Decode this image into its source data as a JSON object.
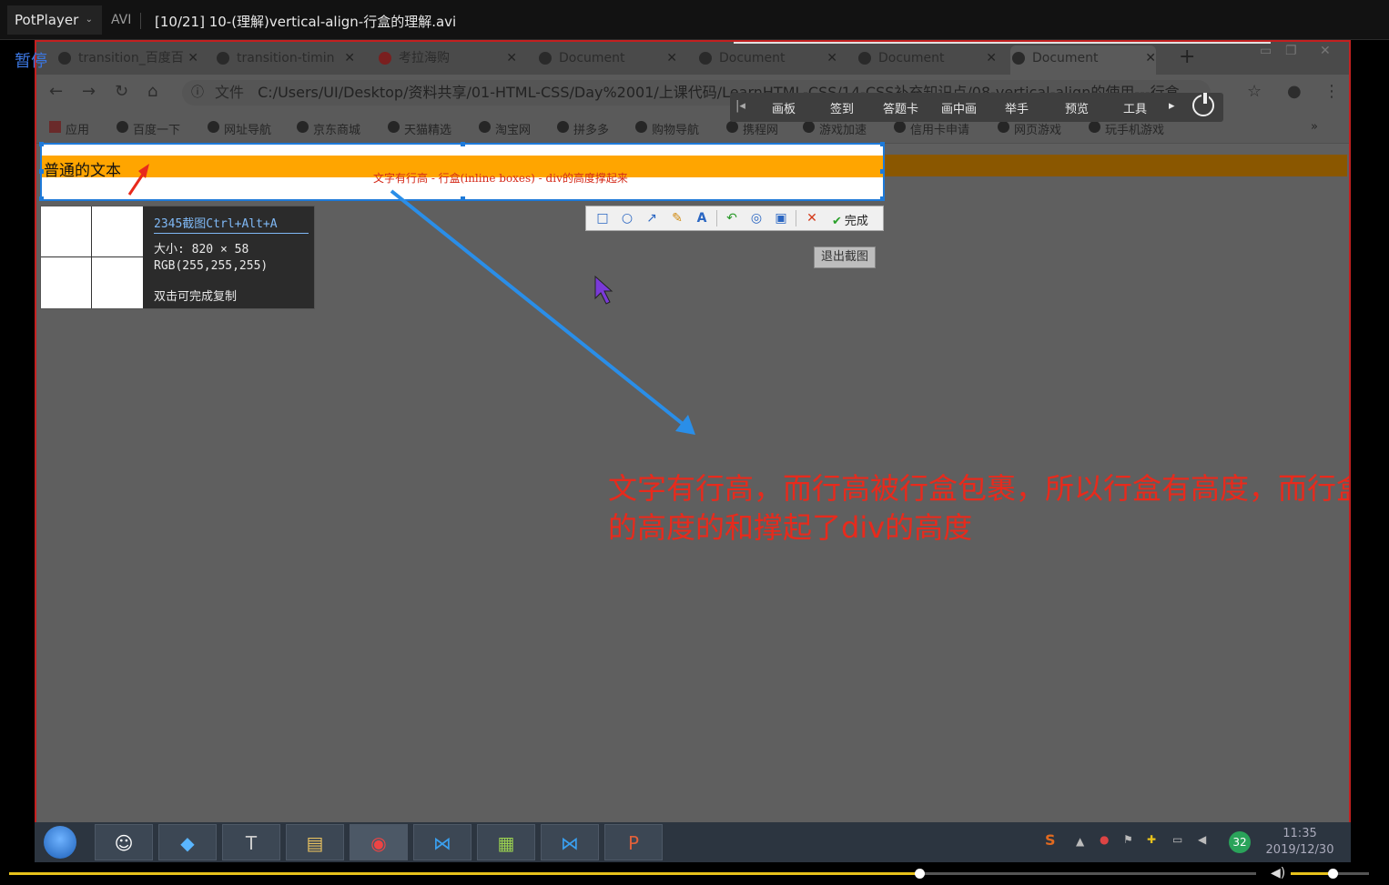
{
  "player": {
    "brand": "PotPlayer",
    "format": "AVI",
    "file_title": "[10/21] 10-(理解)vertical-align-行盒的理解.avi",
    "pause_label": "暂停",
    "seek_progress": 0.73,
    "volume_level": 0.53,
    "accent_color": "#e8c21c"
  },
  "browser": {
    "tabs": [
      {
        "label": "transition_百度百",
        "icon": "baidu-paw-icon"
      },
      {
        "label": "transition-timin",
        "icon": "site-icon"
      },
      {
        "label": "考拉海购",
        "icon": "kaola-icon"
      },
      {
        "label": "Document",
        "icon": "globe-icon"
      },
      {
        "label": "Document",
        "icon": "globe-icon"
      },
      {
        "label": "Document",
        "icon": "globe-icon"
      },
      {
        "label": "Document",
        "icon": "globe-icon"
      }
    ],
    "new_tab": "+",
    "url_prefix": "文件",
    "url": "C:/Users/UI/Desktop/资料共享/01-HTML-CSS/Day%2001/上课代码/LearnHTML-CSS/14-CSS补充知识点/08-vertical-align的使用---行盒",
    "bookmarks": [
      "应用",
      "百度一下",
      "网址导航",
      "京东商城",
      "天猫精选",
      "淘宝网",
      "拼多多",
      "购物导航",
      "携程网",
      "游戏加速",
      "信用卡申请",
      "网页游戏",
      "玩手机游戏"
    ],
    "bookmarks_more": "»"
  },
  "whiteboard": {
    "items": [
      "画板",
      "签到",
      "答题卡",
      "画中画",
      "举手",
      "预览",
      "工具"
    ]
  },
  "page": {
    "normal_text": "普通的文本",
    "annotation": "文字有行高 - 行盒(inline boxes) - div的高度撑起来",
    "big_note": "文字有行高，而行高被行盒包裹，所以行盒有高度，而行盒的高度的和撑起了div的高度"
  },
  "screenshot_tool": {
    "title": "2345截图Ctrl+Alt+A",
    "size": "大小: 820 × 58",
    "rgb": "RGB(255,255,255)",
    "hint": "双击可完成复制",
    "done_label": "完成",
    "exit_label": "退出截图"
  },
  "taskbar": {
    "clock_time": "11:35",
    "clock_date": "2019/12/30",
    "badge": "32",
    "apps": [
      "avatar-app",
      "media-app",
      "typora-app",
      "files-app",
      "chrome-app",
      "vscode-app",
      "notepad-app",
      "vscode-app-2",
      "powerpoint-app"
    ]
  }
}
